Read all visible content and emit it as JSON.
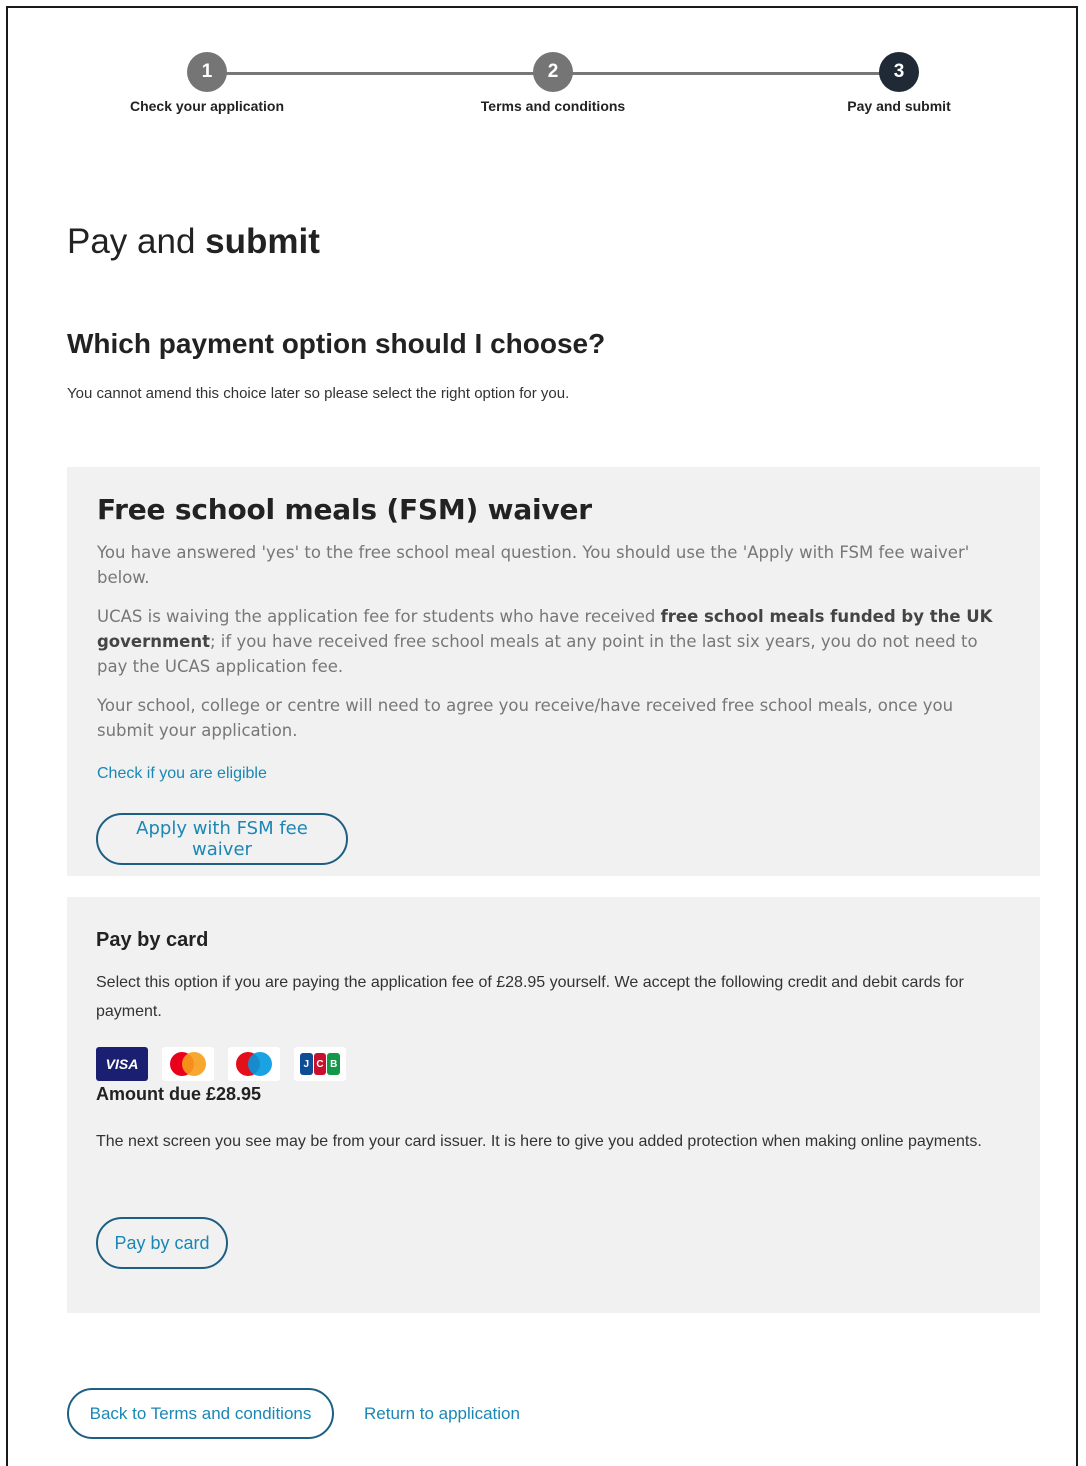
{
  "stepper": {
    "steps": [
      {
        "number": "1",
        "label": "Check your application",
        "state": "complete"
      },
      {
        "number": "2",
        "label": "Terms and conditions",
        "state": "complete"
      },
      {
        "number": "3",
        "label": "Pay and submit",
        "state": "current"
      }
    ]
  },
  "page": {
    "title_light": "Pay and ",
    "title_bold": "submit",
    "section_title": "Which payment option should I choose?",
    "intro": "You cannot amend this choice later so please select the right option for you."
  },
  "fsm": {
    "title": "Free school meals (FSM) waiver",
    "p1": "You have answered 'yes' to the free school meal question. You should use the 'Apply with FSM fee waiver' below.",
    "p2_a": "UCAS is waiving the application fee for students who have received ",
    "p2_bold": "free school meals funded by the UK government",
    "p2_b": "; if you have received free school meals at any point in the last six years, you do not need to pay the UCAS application fee.",
    "p3": "Your school, college or centre will need to agree you receive/have received free school meals, once you submit your application.",
    "eligibility_link": "Check if you are eligible",
    "apply_button": "Apply with FSM fee waiver"
  },
  "card": {
    "title": "Pay by card",
    "description": "Select this option if you are paying the application fee of £28.95 yourself. We accept the following credit and debit cards for payment.",
    "icons": [
      "visa-icon",
      "mastercard-icon",
      "maestro-icon",
      "jcb-icon"
    ],
    "visa_text": "VISA",
    "amount_due": "Amount due £28.95",
    "note": "The next screen you see may be from your card issuer. It is here to give you added protection when making online payments.",
    "pay_button": "Pay by card"
  },
  "footer": {
    "back_button": "Back to Terms and conditions",
    "return_link": "Return to application"
  },
  "colors": {
    "step_complete": "#757575",
    "step_current": "#1f2a36",
    "link": "#1b87b5",
    "panel_bg": "#f1f1f1",
    "button_border": "#1d5f82"
  }
}
